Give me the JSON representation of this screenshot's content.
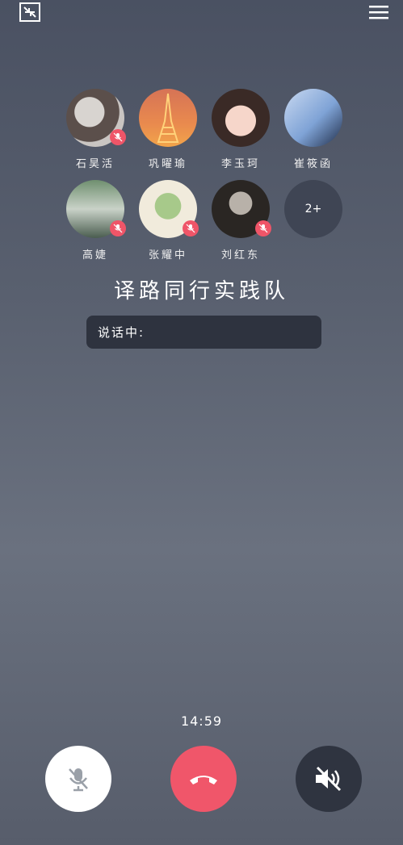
{
  "call": {
    "group_name": "译路同行实践队",
    "speaking_label": "说话中:",
    "timer": "14:59",
    "more_count": "2+"
  },
  "participants": [
    {
      "name": "石昊活",
      "muted": true
    },
    {
      "name": "巩曜瑜",
      "muted": false
    },
    {
      "name": "李玉珂",
      "muted": false
    },
    {
      "name": "崔筱函",
      "muted": false
    },
    {
      "name": "高婕",
      "muted": true
    },
    {
      "name": "张耀中",
      "muted": true
    },
    {
      "name": "刘红东",
      "muted": true
    }
  ],
  "icons": {
    "top_left": "minimize-icon",
    "top_right": "menu-icon",
    "controls": [
      "mic-off-icon",
      "hang-up-icon",
      "speaker-off-icon"
    ]
  },
  "colors": {
    "accent_red": "#f0566a",
    "badge_red": "#ef5568"
  }
}
